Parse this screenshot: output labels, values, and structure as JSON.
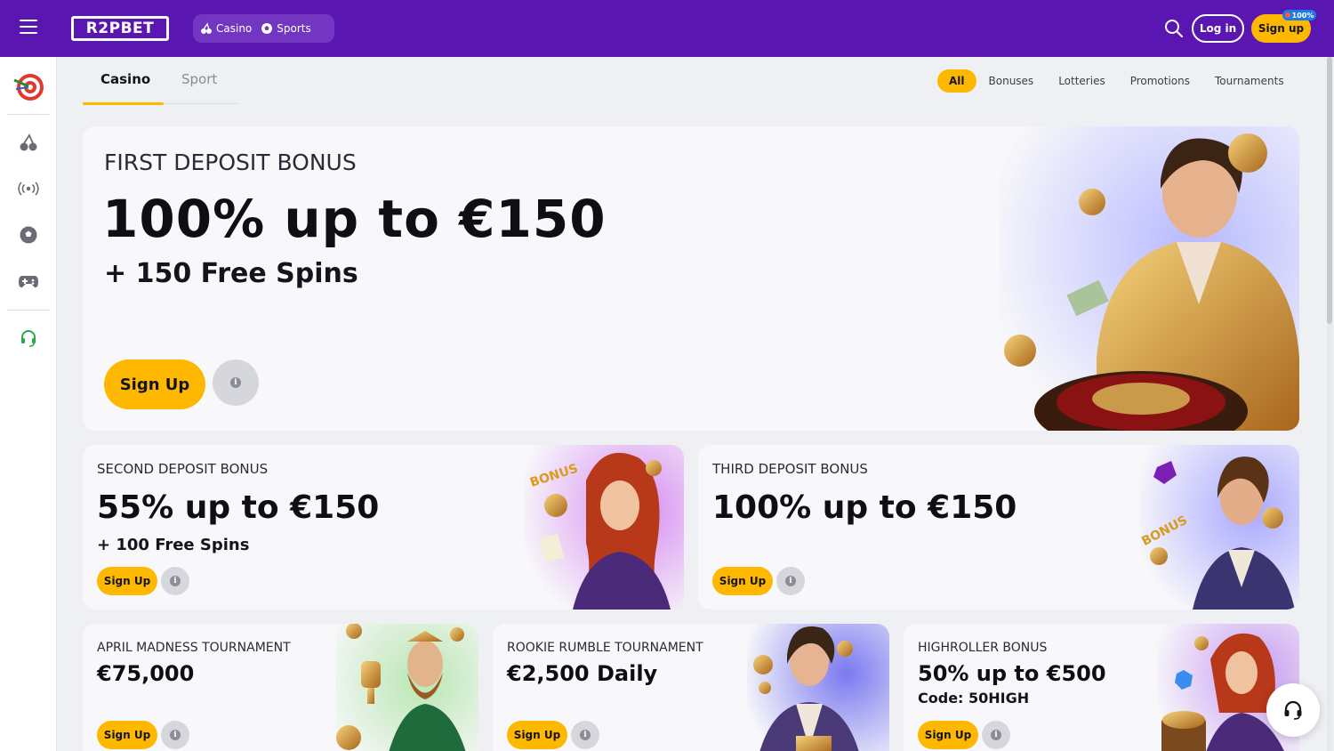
{
  "header": {
    "logo": "R2PBET",
    "nav": [
      {
        "label": "Casino",
        "icon": "cherry-icon"
      },
      {
        "label": "Sports",
        "icon": "soccer-ball-icon"
      }
    ],
    "login_label": "Log in",
    "signup_label": "Sign up",
    "signup_badge": "100%"
  },
  "sidebar": {
    "items": [
      {
        "name": "dartboard-icon"
      },
      {
        "name": "cherry-icon"
      },
      {
        "name": "live-broadcast-icon"
      },
      {
        "name": "soccer-ball-icon"
      },
      {
        "name": "gamepad-icon"
      },
      {
        "name": "headset-icon"
      }
    ]
  },
  "tabs": [
    {
      "label": "Casino",
      "active": true
    },
    {
      "label": "Sport",
      "active": false
    }
  ],
  "filters": [
    {
      "label": "All",
      "active": true
    },
    {
      "label": "Bonuses",
      "active": false
    },
    {
      "label": "Lotteries",
      "active": false
    },
    {
      "label": "Promotions",
      "active": false
    },
    {
      "label": "Tournaments",
      "active": false
    }
  ],
  "promos": {
    "first": {
      "kicker": "FIRST DEPOSIT BONUS",
      "headline": "100% up to €150",
      "sub": "+ 150 Free Spins",
      "cta": "Sign Up"
    },
    "second": {
      "kicker": "SECOND DEPOSIT BONUS",
      "headline": "55% up to €150",
      "sub": "+ 100 Free Spins",
      "cta": "Sign Up",
      "art_text": "BONUS"
    },
    "third": {
      "kicker": "THIRD DEPOSIT BONUS",
      "headline": "100% up to €150",
      "cta": "Sign Up",
      "art_text": "BONUS"
    },
    "april": {
      "kicker": "APRIL MADNESS TOURNAMENT",
      "headline": "€75,000",
      "cta": "Sign Up"
    },
    "rookie": {
      "kicker": "ROOKIE RUMBLE TOURNAMENT",
      "headline": "€2,500 Daily",
      "cta": "Sign Up"
    },
    "highroller": {
      "kicker": "HIGHROLLER BONUS",
      "headline": "50% up to €500",
      "sub": "Code: 50HIGH",
      "cta": "Sign Up"
    }
  },
  "colors": {
    "header_bg": "#5a16b0",
    "accent": "#ffb800",
    "page_bg": "#eef0f3",
    "card_bg": "#f8f8fa"
  }
}
